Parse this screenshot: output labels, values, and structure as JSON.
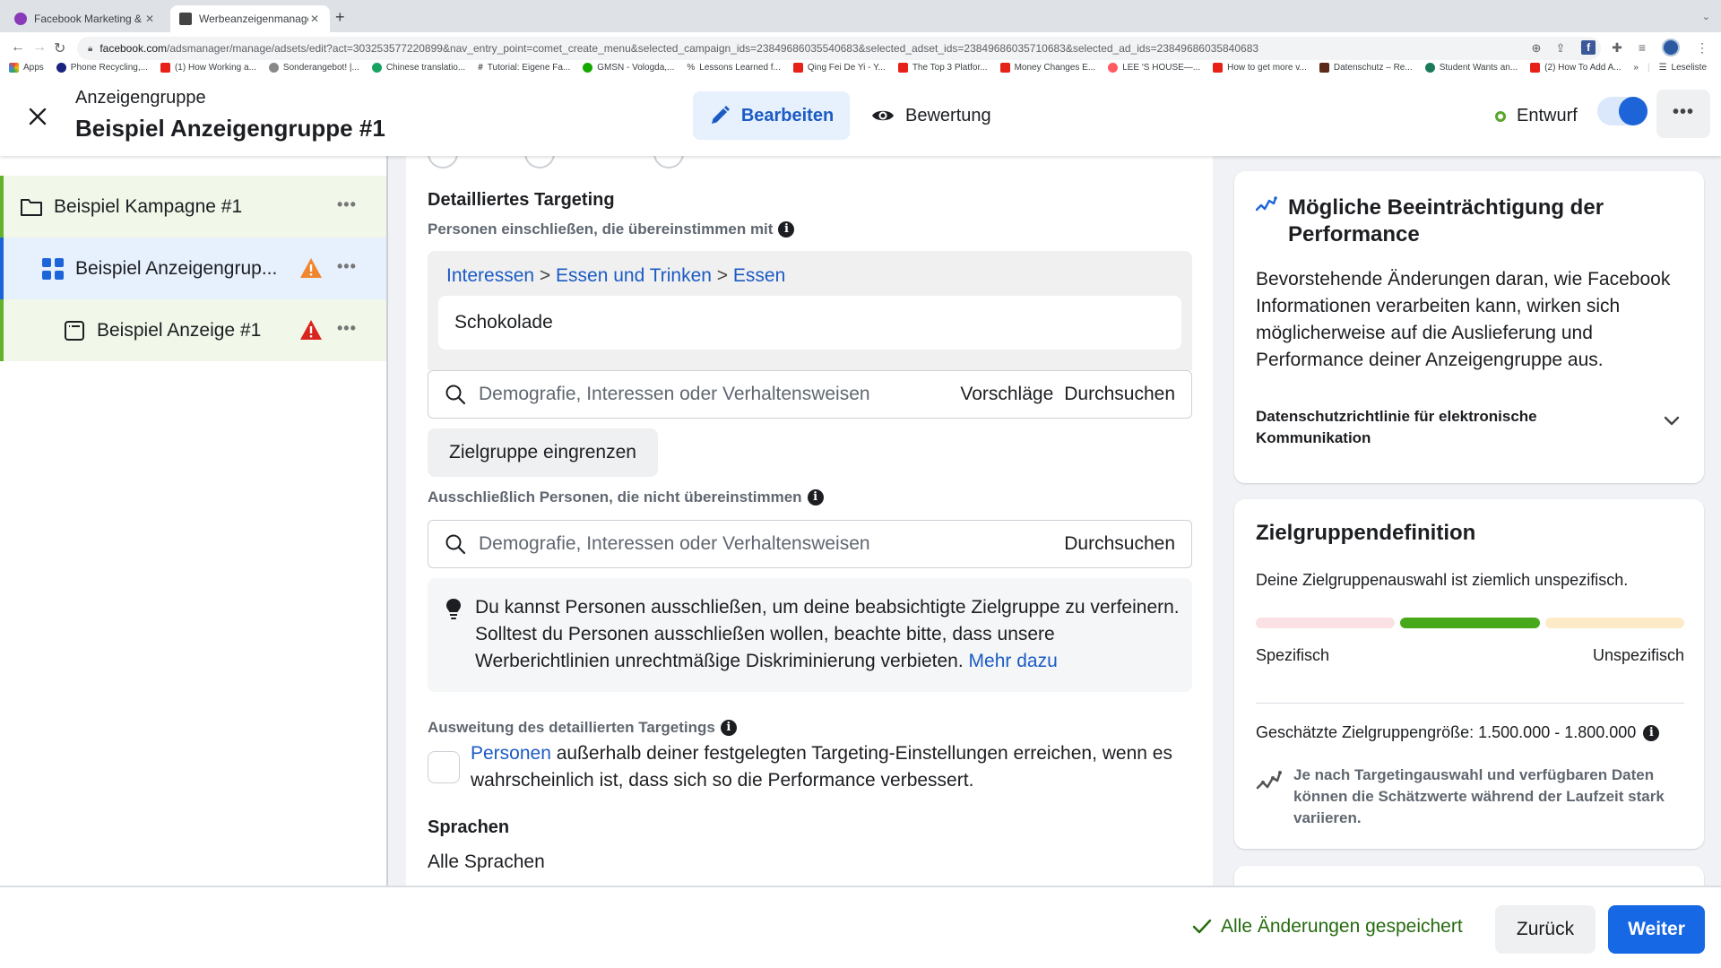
{
  "browser": {
    "tabs": [
      {
        "title": "Facebook Marketing & Werbea",
        "favicon_color": "#8a3ab9",
        "active": false
      },
      {
        "title": "Werbeanzeigenmanager - Wer",
        "favicon_color": "#444444",
        "active": true
      }
    ],
    "url_domain": "facebook.com",
    "url_path": "/adsmanager/manage/adsets/edit?act=303253577220899&nav_entry_point=comet_create_menu&selected_campaign_ids=23849686035540683&selected_adset_ids=23849686035710683&selected_ad_ids=23849686035840683",
    "bookmarks": [
      {
        "label": "Apps",
        "color": "#ea4335"
      },
      {
        "label": "Phone Recycling,...",
        "color": "#1a237e"
      },
      {
        "label": "(1) How Working a...",
        "color": "#e62117"
      },
      {
        "label": "Sonderangebot! |...",
        "color": "#888888"
      },
      {
        "label": "Chinese translatio...",
        "color": "#1aa260"
      },
      {
        "label": "Tutorial: Eigene Fa...",
        "color": "#333333"
      },
      {
        "label": "GMSN - Vologda,...",
        "color": "#14a800"
      },
      {
        "label": "Lessons Learned f...",
        "color": "#555555"
      },
      {
        "label": "Qing Fei De Yi - Y...",
        "color": "#e62117"
      },
      {
        "label": "The Top 3 Platfor...",
        "color": "#e62117"
      },
      {
        "label": "Money Changes E...",
        "color": "#e62117"
      },
      {
        "label": "LEE 'S HOUSE—...",
        "color": "#ff5a5f"
      },
      {
        "label": "How to get more v...",
        "color": "#e62117"
      },
      {
        "label": "Datenschutz – Re...",
        "color": "#5b2a1a"
      },
      {
        "label": "Student Wants an...",
        "color": "#1b7a5a"
      },
      {
        "label": "(2) How To Add A...",
        "color": "#e62117"
      }
    ],
    "overflow_label": "»",
    "reading_list_label": "Leseliste"
  },
  "header": {
    "subtitle": "Anzeigengruppe",
    "title": "Beispiel Anzeigengruppe #1",
    "edit_label": "Bearbeiten",
    "review_label": "Bewertung",
    "status_label": "Entwurf",
    "toggle_on": true,
    "more_label": "•••"
  },
  "sidebar": {
    "items": [
      {
        "label": "Beispiel Kampagne #1",
        "type": "campaign",
        "warning": null
      },
      {
        "label": "Beispiel Anzeigengrup...",
        "type": "adset",
        "warning": "orange"
      },
      {
        "label": "Beispiel Anzeige #1",
        "type": "ad",
        "warning": "red"
      }
    ],
    "dots_label": "•••"
  },
  "main": {
    "detailed_targeting_title": "Detailliertes Targeting",
    "include_label": "Personen einschließen, die übereinstimmen mit",
    "breadcrumb": [
      "Interessen",
      "Essen und Trinken",
      "Essen"
    ],
    "breadcrumb_sep": ">",
    "selected_interest": "Schokolade",
    "include_search": {
      "placeholder": "Demografie, Interessen oder Verhaltensweisen",
      "suggestions_label": "Vorschläge",
      "browse_label": "Durchsuchen"
    },
    "narrow_button": "Zielgruppe eingrenzen",
    "exclude_label": "Ausschließlich Personen, die nicht übereinstimmen",
    "exclude_search": {
      "placeholder": "Demografie, Interessen oder Verhaltensweisen",
      "browse_label": "Durchsuchen"
    },
    "tip_text": "Du kannst Personen ausschließen, um deine beabsichtigte Zielgruppe zu verfeinern. Solltest du Personen ausschließen wollen, beachte bitte, dass unsere Werberichtlinien unrechtmäßige Diskriminierung verbieten.",
    "tip_link": "Mehr dazu",
    "expansion_label": "Ausweitung des detaillierten Targetings",
    "expansion_link": "Personen",
    "expansion_text": "außerhalb deiner festgelegten Targeting-Einstellungen erreichen, wenn es wahrscheinlich ist, dass sich so die Performance verbessert.",
    "expansion_checked": false,
    "languages_title": "Sprachen",
    "languages_value": "Alle Sprachen"
  },
  "right_panel": {
    "performance_card": {
      "title": "Mögliche Beeinträchtigung der Performance",
      "body": "Bevorstehende Änderungen daran, wie Facebook Informationen verarbeiten kann, wirken sich möglicherweise auf die Auslieferung und Performance deiner Anzeigengruppe aus.",
      "policy_label": "Datenschutzrichtlinie für elektronische Kommunikation"
    },
    "audience_card": {
      "title": "Zielgruppendefinition",
      "description": "Deine Zielgruppenauswahl ist ziemlich unspezifisch.",
      "meter_segments": [
        {
          "state": "inactive",
          "color": "#fbe1e3"
        },
        {
          "state": "active",
          "color": "#47a81c"
        },
        {
          "state": "inactive",
          "color": "#fdebc8"
        }
      ],
      "meter_active_index": 1,
      "label_left": "Spezifisch",
      "label_right": "Unspezifisch",
      "size_label": "Geschätzte Zielgruppengröße: 1.500.000 - 1.800.000",
      "note": "Je nach Targetingauswahl und verfügbaren Daten können die Schätzwerte während der Laufzeit stark variieren."
    }
  },
  "footer": {
    "saved_label": "Alle Änderungen gespeichert",
    "back_label": "Zurück",
    "next_label": "Weiter"
  },
  "colors": {
    "primary": "#1768e5",
    "link": "#1b5bc4",
    "success": "#256b0f",
    "warning_orange": "#f0862f",
    "warning_red": "#d9251d"
  }
}
